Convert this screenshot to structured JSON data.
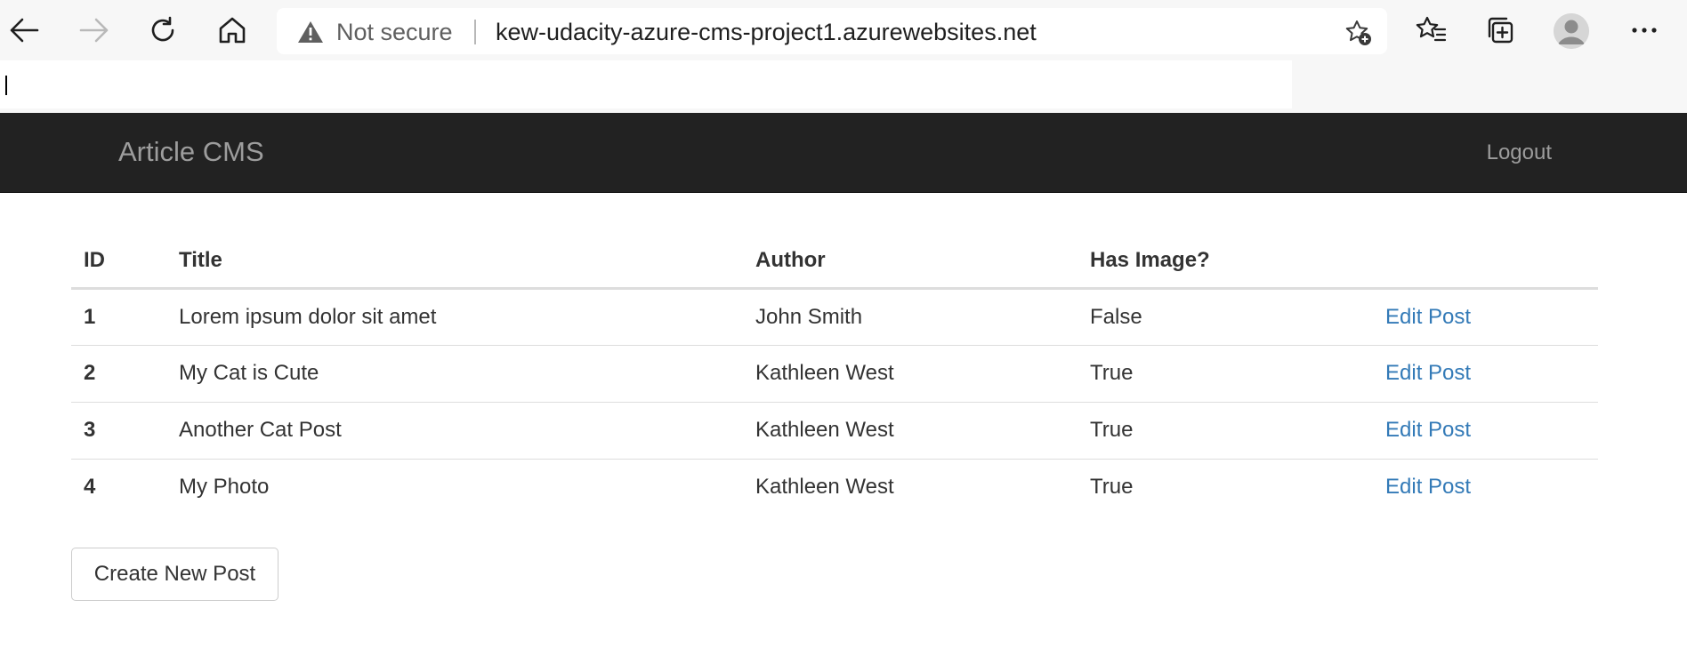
{
  "browser": {
    "security_label": "Not secure",
    "url": "kew-udacity-azure-cms-project1.azurewebsites.net",
    "find_value": ""
  },
  "navbar": {
    "brand": "Article CMS",
    "logout_label": "Logout"
  },
  "table": {
    "headers": {
      "id": "ID",
      "title": "Title",
      "author": "Author",
      "has_image": "Has Image?",
      "action": ""
    },
    "rows": [
      {
        "id": "1",
        "title": "Lorem ipsum dolor sit amet",
        "author": "John Smith",
        "has_image": "False",
        "action": "Edit Post"
      },
      {
        "id": "2",
        "title": "My Cat is Cute",
        "author": "Kathleen West",
        "has_image": "True",
        "action": "Edit Post"
      },
      {
        "id": "3",
        "title": "Another Cat Post",
        "author": "Kathleen West",
        "has_image": "True",
        "action": "Edit Post"
      },
      {
        "id": "4",
        "title": "My Photo",
        "author": "Kathleen West",
        "has_image": "True",
        "action": "Edit Post"
      }
    ]
  },
  "create_button_label": "Create New Post",
  "colors": {
    "navbar_bg": "#222222",
    "navbar_text": "#9d9d9d",
    "link": "#337ab7",
    "warning_icon": "#5f5f5f"
  },
  "icons": {
    "back": "back-arrow-icon",
    "forward": "forward-arrow-icon",
    "refresh": "refresh-icon",
    "home": "home-icon",
    "warning": "warning-triangle-icon",
    "add_favorite": "add-favorite-star-icon",
    "favorites": "favorites-icon",
    "collections": "collections-icon",
    "profile": "profile-avatar-icon",
    "menu": "more-menu-icon"
  }
}
